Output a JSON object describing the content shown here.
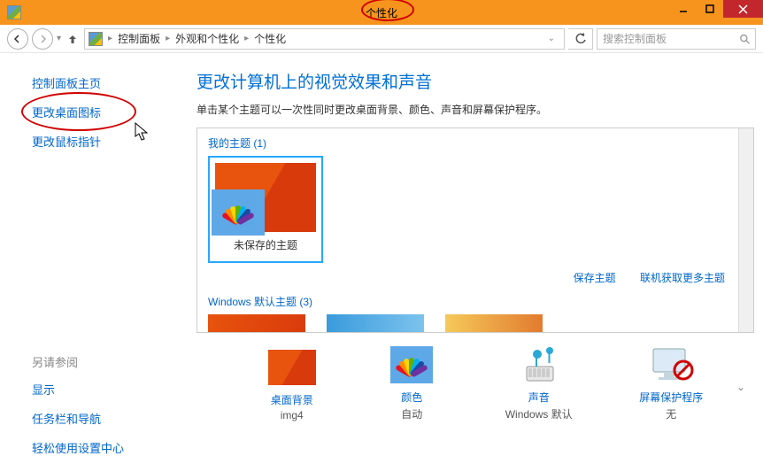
{
  "window": {
    "title": "个性化"
  },
  "breadcrumb": {
    "root_label": "控制面板",
    "cat_label": "外观和个性化",
    "page_label": "个性化"
  },
  "search": {
    "placeholder": "搜索控制面板"
  },
  "sidebar": {
    "home": "控制面板主页",
    "change_icons": "更改桌面图标",
    "change_pointer": "更改鼠标指针",
    "see_also_hdr": "另请参阅",
    "display": "显示",
    "taskbar": "任务栏和导航",
    "ease": "轻松使用设置中心"
  },
  "main": {
    "heading": "更改计算机上的视觉效果和声音",
    "subtext": "单击某个主题可以一次性同时更改桌面背景、颜色、声音和屏幕保护程序。"
  },
  "themes": {
    "my_themes_label": "我的主题 (1)",
    "unsaved_name": "未保存的主题",
    "save_label": "保存主题",
    "get_more_label": "联机获取更多主题",
    "default_label": "Windows 默认主题 (3)"
  },
  "bottom": {
    "bg_label": "桌面背景",
    "bg_val": "img4",
    "color_label": "颜色",
    "color_val": "自动",
    "sound_label": "声音",
    "sound_val": "Windows 默认",
    "saver_label": "屏幕保护程序",
    "saver_val": "无"
  }
}
